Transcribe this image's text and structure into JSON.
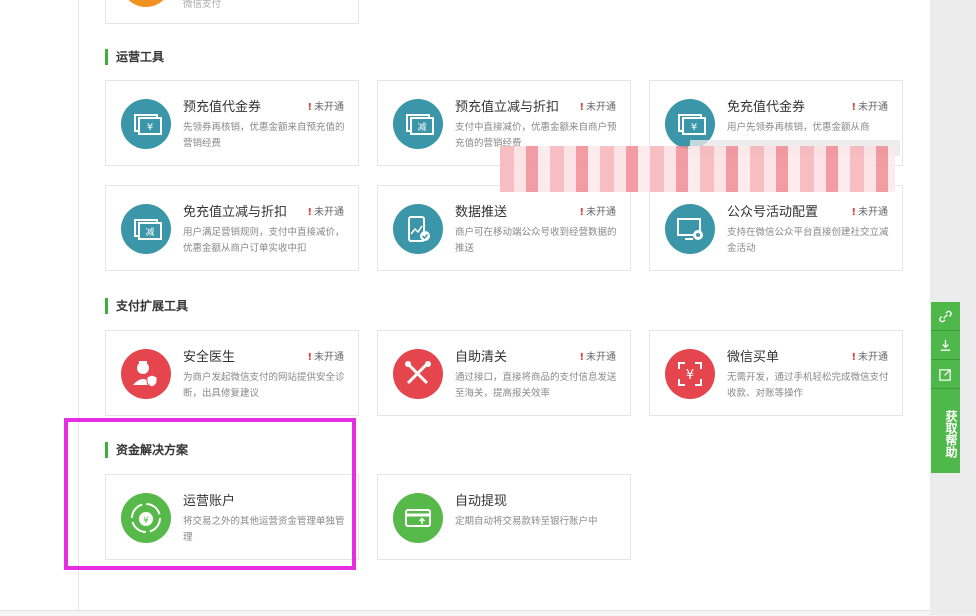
{
  "top_card": {
    "partial_text": "微信支付"
  },
  "sections": [
    {
      "title": "运营工具"
    },
    {
      "title": "支付扩展工具"
    },
    {
      "title": "资金解决方案"
    }
  ],
  "cards": [
    {
      "title": "预充值代金券",
      "status": "未开通",
      "desc": "先领券再核销，优惠金额来自预充值的营销经费"
    },
    {
      "title": "预充值立减与折扣",
      "status": "未开通",
      "desc": "支付中直接减价，优惠金额来自商户预充值的营销经费"
    },
    {
      "title": "免充值代金券",
      "status": "未开通",
      "desc": "用户先领券再核销，优惠金额从商"
    },
    {
      "title": "免充值立减与折扣",
      "status": "未开通",
      "desc": "用户满足营销规则，支付中直接减价，优惠金额从商户订单实收中扣"
    },
    {
      "title": "数据推送",
      "status": "未开通",
      "desc": "商户可在移动端公众号收到经营数据的推送"
    },
    {
      "title": "公众号活动配置",
      "status": "未开通",
      "desc": "支持在微信公众平台直接创建社交立减金活动"
    },
    {
      "title": "安全医生",
      "status": "未开通",
      "desc": "为商户发起微信支付的网站提供安全诊断，出具修复建议"
    },
    {
      "title": "自助清关",
      "status": "未开通",
      "desc": "通过接口，直接将商品的支付信息发送至海关，提高报关效率"
    },
    {
      "title": "微信买单",
      "status": "未开通",
      "desc": "无需开发，通过手机轻松完成微信支付收款、对账等操作"
    },
    {
      "title": "运营账户",
      "status": "",
      "desc": "将交易之外的其他运营资金管理单独管理"
    },
    {
      "title": "自动提现",
      "status": "",
      "desc": "定期自动将交易款转至银行账户中"
    }
  ],
  "help": {
    "label": "获取帮助",
    "icons": [
      "link-icon",
      "download-icon",
      "edit-icon"
    ]
  },
  "colors": {
    "teal": "#3a96a8",
    "red": "#e5454d",
    "green": "#56b94a",
    "accent": "#4fb84a",
    "highlight": "#e52ee3",
    "warn": "#e23c3c"
  }
}
